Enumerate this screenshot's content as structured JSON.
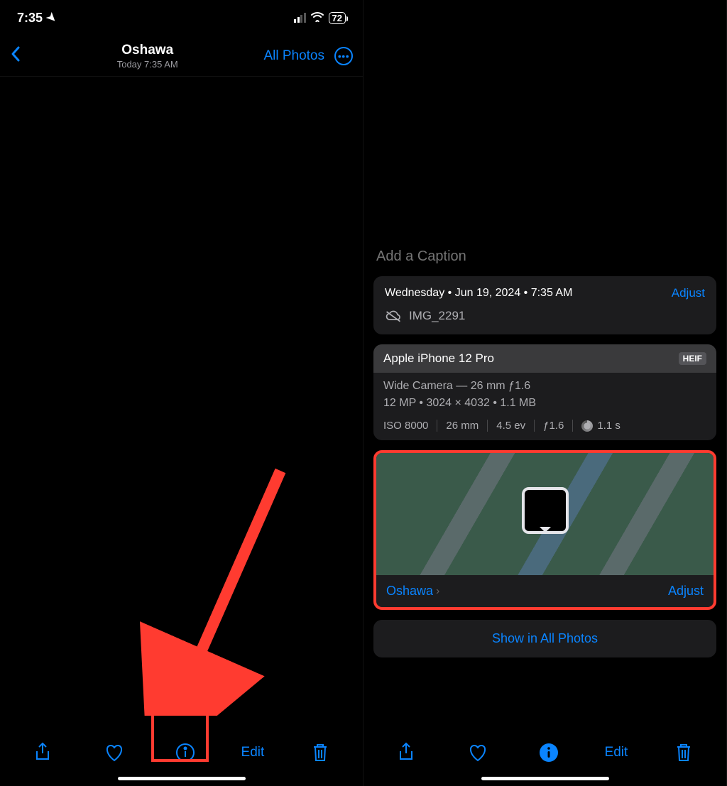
{
  "colors": {
    "accent": "#0a84ff",
    "highlight": "#ff3b30"
  },
  "left": {
    "status": {
      "time": "7:35",
      "battery": "72"
    },
    "nav": {
      "title": "Oshawa",
      "subtitle": "Today  7:35 AM",
      "all_photos": "All Photos"
    },
    "toolbar": {
      "edit": "Edit"
    }
  },
  "right": {
    "caption_placeholder": "Add a Caption",
    "meta": {
      "date_line": "Wednesday • Jun 19, 2024 • 7:35 AM",
      "adjust": "Adjust",
      "filename": "IMG_2291"
    },
    "camera": {
      "device": "Apple iPhone 12 Pro",
      "format": "HEIF",
      "lens_line": "Wide Camera — 26 mm ƒ1.6",
      "res_line": "12 MP  •  3024 × 4032  •  1.1 MB",
      "specs": {
        "iso": "ISO 8000",
        "focal": "26 mm",
        "ev": "4.5 ev",
        "aperture": "ƒ1.6",
        "shutter": "1.1 s"
      }
    },
    "map": {
      "location": "Oshawa",
      "adjust": "Adjust"
    },
    "show_all": "Show in All Photos",
    "toolbar": {
      "edit": "Edit"
    }
  }
}
